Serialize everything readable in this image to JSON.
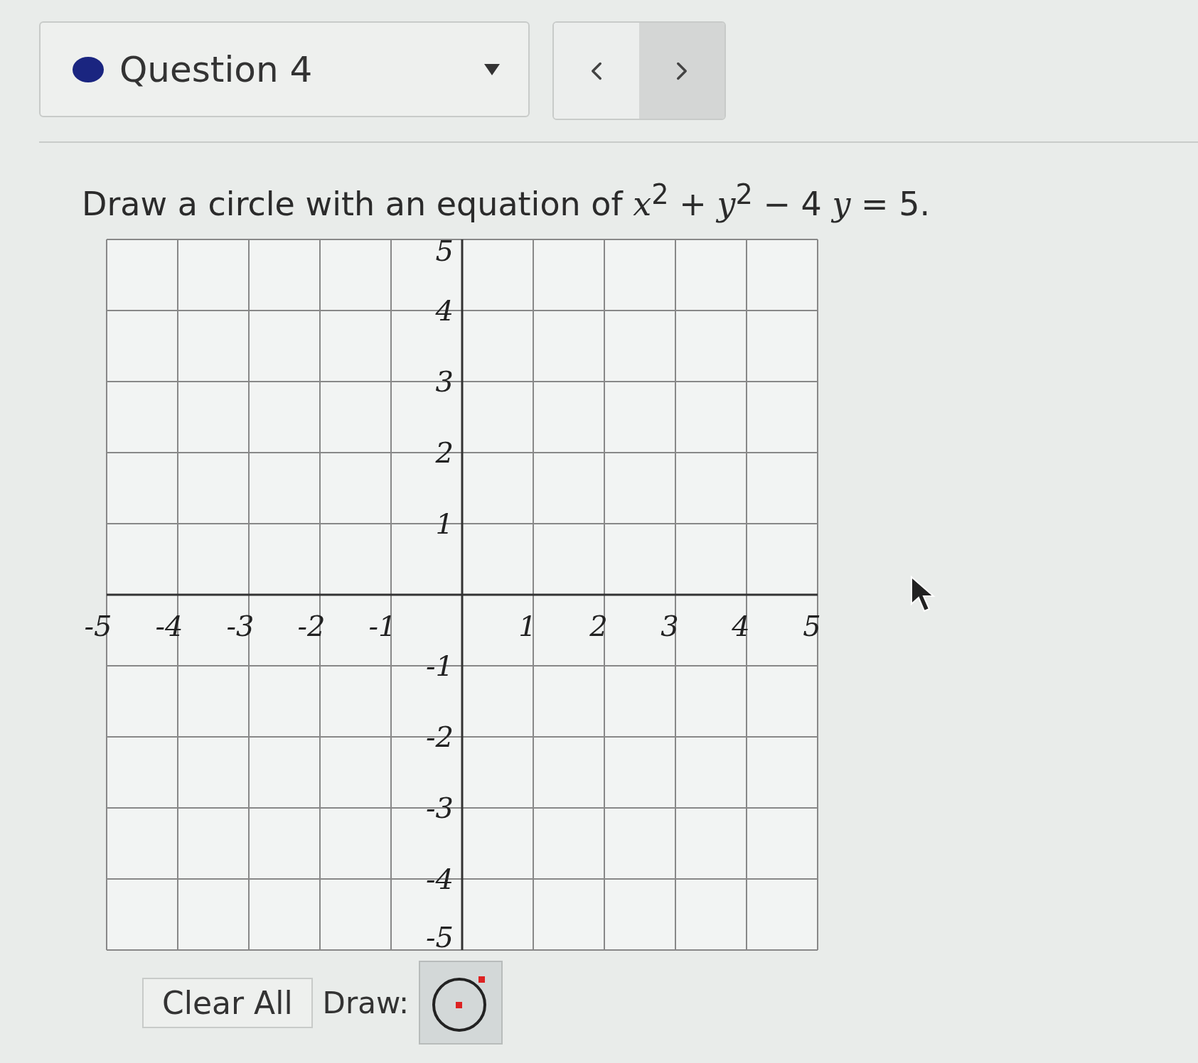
{
  "header": {
    "question_label": "Question 4"
  },
  "prompt": "Draw a circle with an equation of *x*$^{2}$ + *y*$^{2}$ − 4 *y* = 5.",
  "graph": {
    "x_tick_labels": [
      "-5",
      "-4",
      "-3",
      "-2",
      "-1",
      "1",
      "2",
      "3",
      "4",
      "5"
    ],
    "y_tick_labels": [
      "5",
      "4",
      "3",
      "2",
      "1",
      "-1",
      "-2",
      "-3",
      "-4",
      "-5"
    ]
  },
  "tools": {
    "clear_button": "Clear All",
    "draw_label": "Draw:",
    "circle_tool": {
      "selected": true
    }
  }
}
